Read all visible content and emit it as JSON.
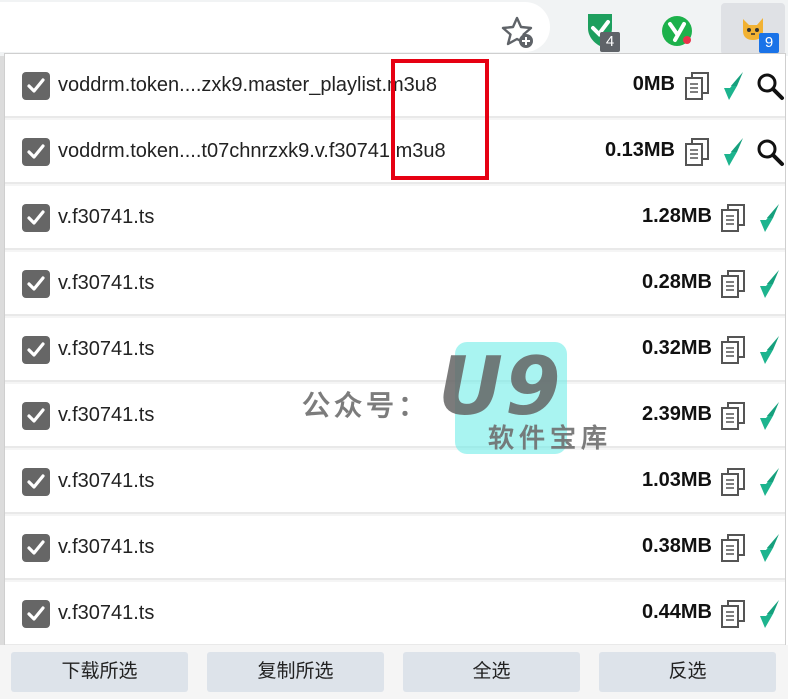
{
  "toolbar": {
    "shield_badge": "4",
    "cat_badge": "9",
    "icons": [
      "bookmark-star-icon",
      "shield-check-extension-icon",
      "y-extension-icon",
      "cat-sniffer-extension-icon"
    ]
  },
  "files": [
    {
      "name": "voddrm.token....zxk9.master_playlist.m3u8",
      "size": "0MB",
      "checked": true,
      "icons": [
        "copy-icon",
        "download-arrow-icon",
        "search-icon"
      ]
    },
    {
      "name": "voddrm.token....t07chnrzxk9.v.f30741.m3u8",
      "size": "0.13MB",
      "checked": true,
      "icons": [
        "copy-icon",
        "download-arrow-icon",
        "search-icon"
      ]
    },
    {
      "name": "v.f30741.ts",
      "size": "1.28MB",
      "checked": true,
      "icons": [
        "copy-icon",
        "download-arrow-icon"
      ]
    },
    {
      "name": "v.f30741.ts",
      "size": "0.28MB",
      "checked": true,
      "icons": [
        "copy-icon",
        "download-arrow-icon"
      ]
    },
    {
      "name": "v.f30741.ts",
      "size": "0.32MB",
      "checked": true,
      "icons": [
        "copy-icon",
        "download-arrow-icon"
      ]
    },
    {
      "name": "v.f30741.ts",
      "size": "2.39MB",
      "checked": true,
      "icons": [
        "copy-icon",
        "download-arrow-icon"
      ]
    },
    {
      "name": "v.f30741.ts",
      "size": "1.03MB",
      "checked": true,
      "icons": [
        "copy-icon",
        "download-arrow-icon"
      ]
    },
    {
      "name": "v.f30741.ts",
      "size": "0.38MB",
      "checked": true,
      "icons": [
        "copy-icon",
        "download-arrow-icon"
      ]
    },
    {
      "name": "v.f30741.ts",
      "size": "0.44MB",
      "checked": true,
      "icons": [
        "copy-icon",
        "download-arrow-icon"
      ]
    }
  ],
  "footer": {
    "download_selected": "下载所选",
    "copy_selected": "复制所选",
    "select_all": "全选",
    "invert_selection": "反选"
  },
  "watermark": {
    "prefix": "公众号：",
    "brand": "U9",
    "sub": "软件宝库"
  },
  "colors": {
    "accent_green": "#1db48e",
    "checkbox": "#666666",
    "highlight_red": "#e60012",
    "button_bg": "#dde3ea"
  }
}
